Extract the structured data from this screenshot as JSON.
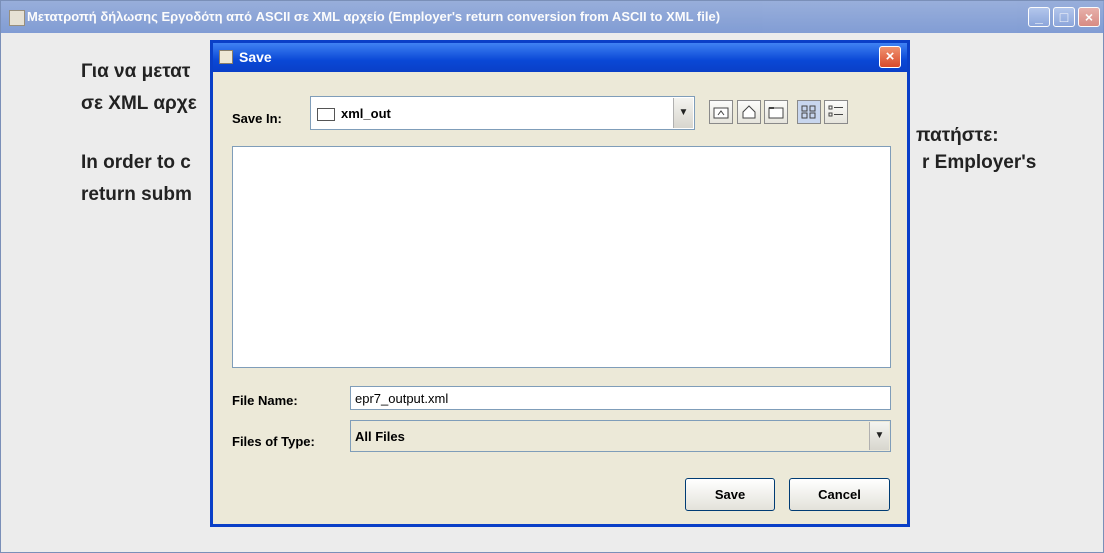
{
  "main_window": {
    "title": "Μετατροπή δήλωσης Εργοδότη από ASCII σε XML αρχείο (Employer's return conversion from ASCII to XML file)",
    "greek_line1": "Για να μετατ",
    "greek_line2": "σε XML αρχε",
    "greek_line2_tail": "πατήστε:",
    "english_line1": "In order to c",
    "english_line1_tail": "r Employer's",
    "english_line2": "return subm"
  },
  "dialog": {
    "title": "Save",
    "close_glyph": "×",
    "save_in_label": "Save In:",
    "save_in_value": "xml_out",
    "file_name_label": "File Name:",
    "file_name_value": "epr7_output.xml",
    "file_type_label": "Files of Type:",
    "file_type_value": "All Files",
    "save_button": "Save",
    "cancel_button": "Cancel"
  },
  "icons": {
    "up_one_level": "up-folder-icon",
    "home": "home-icon",
    "new_folder": "new-folder-icon",
    "list_view": "list-view-icon",
    "details_view": "details-view-icon"
  },
  "colors": {
    "dialog_border": "#0a3fc7",
    "dialog_title_bar": "#0a48d6",
    "close_button": "#d8492a",
    "dialog_body": "#ece9d8"
  }
}
